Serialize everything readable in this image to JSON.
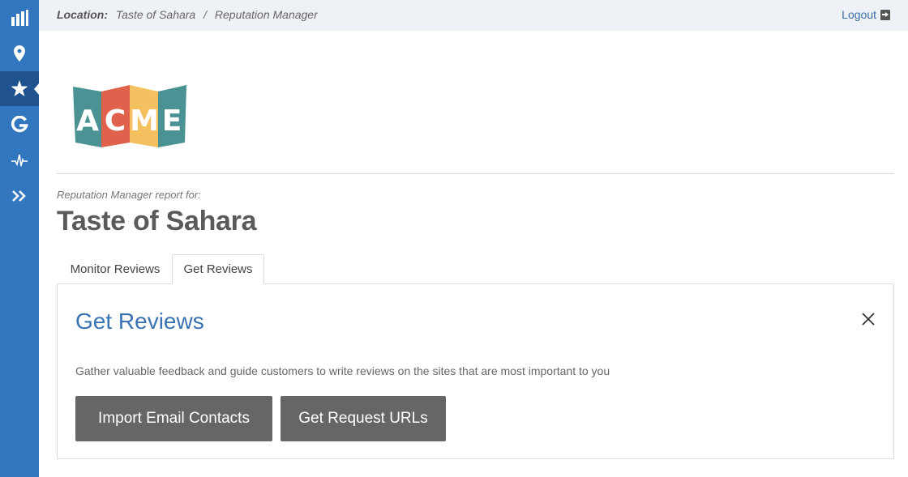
{
  "sidebar": {
    "items": [
      {
        "name": "reports",
        "icon": "bar-chart-icon",
        "active": false
      },
      {
        "name": "locations",
        "icon": "map-pin-icon",
        "active": false
      },
      {
        "name": "reputation",
        "icon": "star-icon",
        "active": true
      },
      {
        "name": "google",
        "icon": "google-g-icon",
        "active": false
      },
      {
        "name": "activity",
        "icon": "pulse-icon",
        "active": false
      },
      {
        "name": "expand",
        "icon": "double-chevron-right-icon",
        "active": false
      }
    ],
    "colors": {
      "background": "#3276c0",
      "active": "#1f528f"
    }
  },
  "topbar": {
    "location_label": "Location:",
    "breadcrumb": [
      "Taste of Sahara",
      "Reputation Manager"
    ],
    "separator": "/",
    "logout_label": "Logout",
    "logout_icon": "logout-icon"
  },
  "logo": {
    "letters": [
      "A",
      "C",
      "M",
      "E"
    ],
    "colors": [
      "#4a9294",
      "#e0624c",
      "#f5c060",
      "#4a9294"
    ]
  },
  "report": {
    "subtitle": "Reputation Manager report for:",
    "name": "Taste of Sahara"
  },
  "tabs": [
    {
      "label": "Monitor Reviews",
      "active": false
    },
    {
      "label": "Get Reviews",
      "active": true
    }
  ],
  "panel": {
    "title": "Get Reviews",
    "close_icon": "close-icon",
    "description": "Gather valuable feedback and guide customers to write reviews on the sites that are most important to you",
    "buttons": {
      "import": "Import Email Contacts",
      "urls": "Get Request URLs"
    }
  }
}
